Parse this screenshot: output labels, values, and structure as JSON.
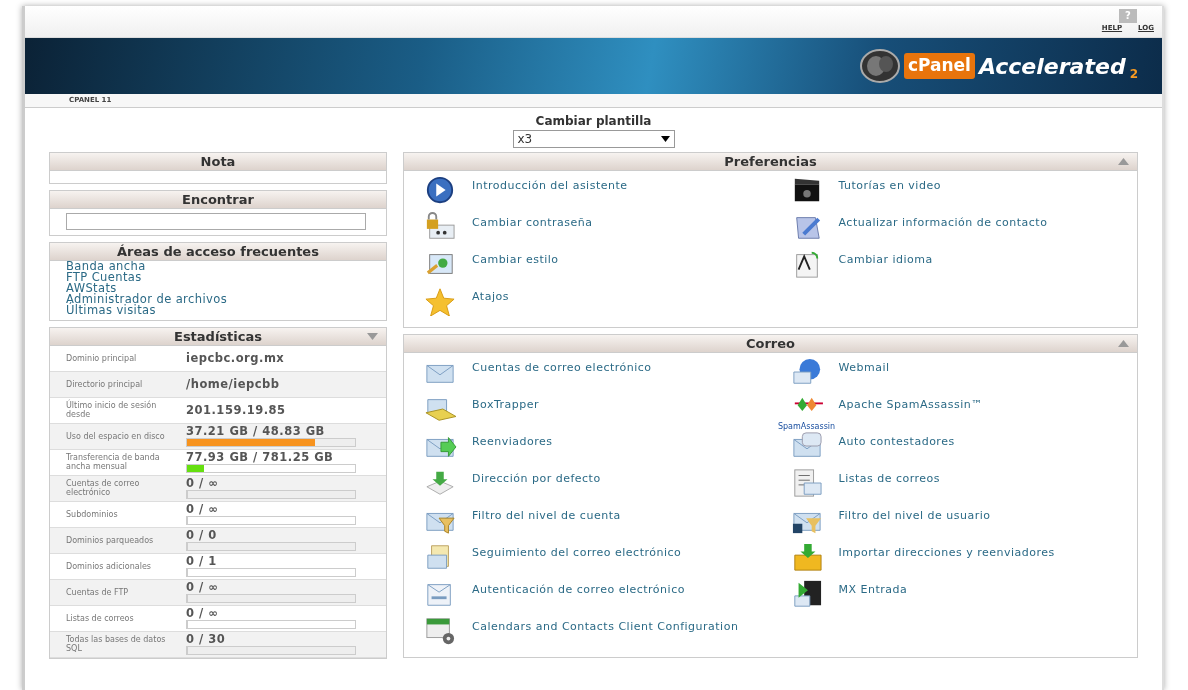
{
  "top_bar": {
    "help_glyph": "?",
    "links": [
      "HELP",
      "LOG"
    ]
  },
  "banner": {
    "logo_word": "cPanel",
    "logo_product": "Accelerated",
    "logo_version": "2"
  },
  "tab": "CPANEL 11",
  "template": {
    "label": "Cambiar plantilla",
    "value": "x3"
  },
  "nota": {
    "title": "Nota"
  },
  "encontrar": {
    "title": "Encontrar"
  },
  "areas": {
    "title": "Áreas de acceso frecuentes",
    "links": [
      "Banda ancha",
      "FTP Cuentas",
      "AWStats",
      "Administrador de archivos",
      "Últimas visitas"
    ]
  },
  "estadisticas": {
    "title": "Estadísticas",
    "expanded": true,
    "rows": [
      {
        "label": "Dominio principal",
        "value": "iepcbc.org.mx"
      },
      {
        "label": "Directorio principal",
        "value": "/home/iepcbb"
      },
      {
        "label": "Último inicio de sesión desde",
        "value": "201.159.19.85"
      },
      {
        "label": "Uso del espacio en disco",
        "value": "37.21 GB / 48.83 GB",
        "level": 0.76,
        "color": "#f7931e"
      },
      {
        "label": "Transferencia de banda ancha mensual",
        "value": "77.93 GB / 781.25 GB",
        "level": 0.1,
        "color": "#66e010"
      },
      {
        "label": "Cuentas de correo electrónico",
        "value": "0 / ∞",
        "level": 0
      },
      {
        "label": "Subdominios",
        "value": "0 / ∞",
        "level": 0
      },
      {
        "label": "Dominios parqueados",
        "value": "0 / 0",
        "level": 0
      },
      {
        "label": "Dominios adicionales",
        "value": "0 / 1",
        "level": 0
      },
      {
        "label": "Cuentas de FTP",
        "value": "0 / ∞",
        "level": 0
      },
      {
        "label": "Listas de correos",
        "value": "0 / ∞",
        "level": 0
      },
      {
        "label": "Todas las bases de datos SQL",
        "value": "0 / 30",
        "level": 0
      }
    ]
  },
  "sections": [
    {
      "title": "Preferencias",
      "expanded": true,
      "items": [
        {
          "label": "Introducción del asistente"
        },
        {
          "label": "Tutorías en video"
        },
        {
          "label": "Cambiar contraseña"
        },
        {
          "label": "Actualizar información de contacto"
        },
        {
          "label": "Cambiar estilo"
        },
        {
          "label": "Cambiar idioma"
        },
        {
          "label": "Atajos"
        }
      ]
    },
    {
      "title": "Correo",
      "expanded": true,
      "items": [
        {
          "label": "Cuentas de correo electrónico"
        },
        {
          "label": "Webmail"
        },
        {
          "label": "BoxTrapper"
        },
        {
          "label": "Apache SpamAssassin™",
          "icon_caption": "SpamAssassin"
        },
        {
          "label": "Reenviadores"
        },
        {
          "label": "Auto contestadores"
        },
        {
          "label": "Dirección por defecto"
        },
        {
          "label": "Listas de correos"
        },
        {
          "label": "Filtro del nivel de cuenta"
        },
        {
          "label": "Filtro del nivel de usuario"
        },
        {
          "label": "Seguimiento del correo electrónico"
        },
        {
          "label": "Importar direcciones y reenviadores"
        },
        {
          "label": "Autenticación de correo electrónico"
        },
        {
          "label": "MX Entrada"
        },
        {
          "label": "Calendars and Contacts Client Configuration"
        }
      ]
    }
  ]
}
